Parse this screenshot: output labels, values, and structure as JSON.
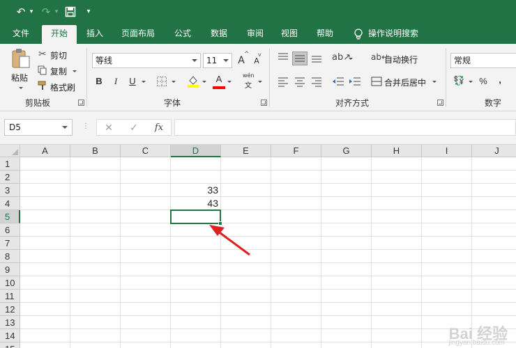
{
  "quick_access": {
    "undo_label": "↶",
    "redo_label": "↷",
    "save_label": "💾",
    "customize_label": "▾"
  },
  "tabs": [
    "文件",
    "开始",
    "插入",
    "页面布局",
    "公式",
    "数据",
    "审阅",
    "视图",
    "帮助"
  ],
  "active_tab": "开始",
  "tell_me": "操作说明搜索",
  "clipboard": {
    "paste": "粘贴",
    "cut": "剪切",
    "copy": "复制",
    "format_painter": "格式刷",
    "group": "剪贴板"
  },
  "font": {
    "family": "等线",
    "size": "11",
    "grow": "A",
    "shrink": "A",
    "bold": "B",
    "italic": "I",
    "underline": "U",
    "font_color_letter": "A",
    "phonetic_top": "wén",
    "phonetic_bottom": "文",
    "group": "字体",
    "fill_color": "#ffff00",
    "text_color": "#ff0000"
  },
  "alignment": {
    "wrap_text": "自动换行",
    "merge_center": "合并后居中",
    "group": "对齐方式"
  },
  "number": {
    "format": "常规",
    "percent": "%",
    "comma": ",",
    "group": "数字"
  },
  "formula_bar": {
    "name_box": "D5",
    "cancel": "✕",
    "enter": "✓",
    "fx": "fx",
    "content": ""
  },
  "sheet": {
    "columns": [
      "A",
      "B",
      "C",
      "D",
      "E",
      "F",
      "G",
      "H",
      "I",
      "J"
    ],
    "rows": [
      "1",
      "2",
      "3",
      "4",
      "5",
      "6",
      "7",
      "8",
      "9",
      "10",
      "11",
      "12",
      "13",
      "14",
      "15"
    ],
    "selected_column": "D",
    "selected_row": "5",
    "cells": [
      {
        "ref": "D3",
        "value": "33"
      },
      {
        "ref": "D4",
        "value": "43"
      }
    ]
  },
  "annotation_color": "#e02020",
  "theme_color": "#217346",
  "watermark": "Bai 经验",
  "watermark_sub": "jingyan.baidu.com"
}
